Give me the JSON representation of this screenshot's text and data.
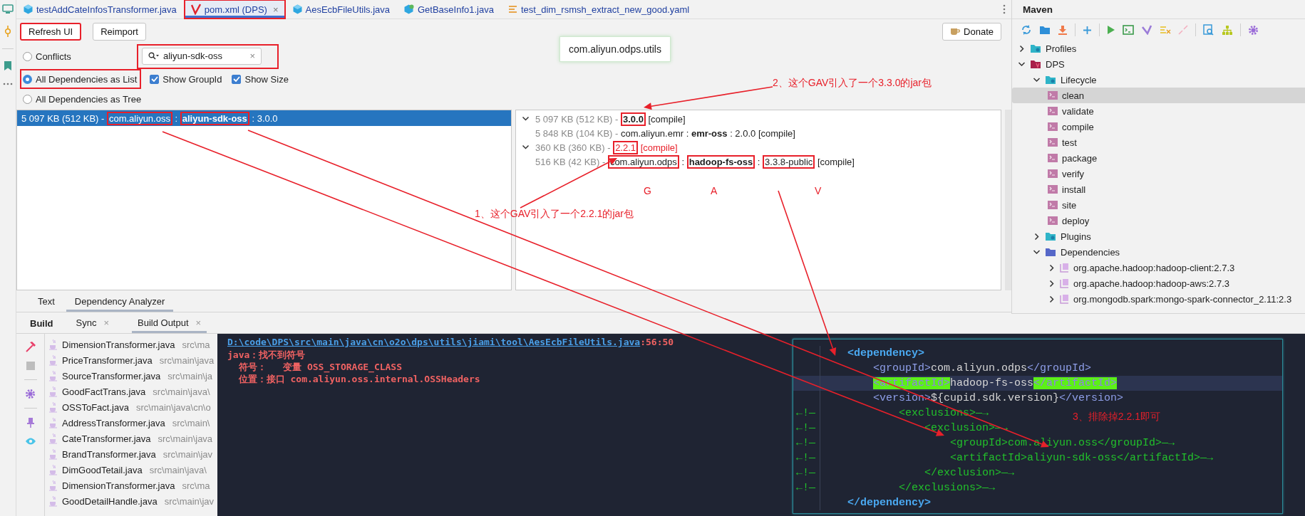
{
  "editor_tabs": [
    {
      "label": "testAddCateInfosTransformer.java",
      "kind": "java",
      "selected": false,
      "annotated": false
    },
    {
      "label": "pom.xml (DPS)",
      "kind": "maven",
      "selected": true,
      "annotated": true,
      "close": "×"
    },
    {
      "label": "AesEcbFileUtils.java",
      "kind": "java",
      "selected": false,
      "annotated": false
    },
    {
      "label": "GetBaseInfo1.java",
      "kind": "class",
      "selected": false,
      "annotated": false
    },
    {
      "label": "test_dim_rsmsh_extract_new_good.yaml",
      "kind": "yaml",
      "selected": false,
      "annotated": false
    }
  ],
  "buttons": [
    {
      "label": "Refresh UI",
      "annotated": true
    },
    {
      "label": "Reimport",
      "annotated": false
    }
  ],
  "donate": {
    "label": "Donate"
  },
  "view_options": [
    {
      "label": "Conflicts",
      "selected": false,
      "annotated": false
    },
    {
      "label": "All Dependencies as List",
      "selected": true,
      "annotated": true
    },
    {
      "label": "All Dependencies as Tree",
      "selected": false,
      "annotated": false
    }
  ],
  "search": {
    "value": "aliyun-sdk-oss",
    "annotated": true,
    "clear": "×"
  },
  "checkboxes": [
    {
      "label": "Show GroupId",
      "checked": true
    },
    {
      "label": "Show Size",
      "checked": true
    }
  ],
  "tooltip": "com.aliyun.odps.utils",
  "dependency_list": [
    {
      "selected": true,
      "segments": [
        {
          "text": "5 097 KB (512 KB) - ",
          "kind": "size",
          "boxed": false
        },
        {
          "text": "com.aliyun.oss",
          "kind": "plain",
          "boxed": true
        },
        {
          "text": " : ",
          "kind": "plain",
          "boxed": false
        },
        {
          "text": "aliyun-sdk-oss",
          "kind": "bold",
          "boxed": true
        },
        {
          "text": " : 3.0.0",
          "kind": "plain",
          "boxed": false
        }
      ]
    }
  ],
  "usage_tree": [
    {
      "expanded": true,
      "segments": [
        {
          "text": "5 097 KB (512 KB) - ",
          "kind": "size",
          "boxed": false
        },
        {
          "text": "3.0.0",
          "kind": "bold",
          "boxed": true
        },
        {
          "text": " [compile]",
          "kind": "plain",
          "boxed": false
        }
      ],
      "children": [
        {
          "segments": [
            {
              "text": "5 848 KB (104 KB) - ",
              "kind": "size",
              "boxed": false
            },
            {
              "text": "com.aliyun.emr : ",
              "kind": "plain",
              "boxed": false
            },
            {
              "text": "emr-oss",
              "kind": "bold",
              "boxed": false
            },
            {
              "text": " : 2.0.0 [compile]",
              "kind": "plain",
              "boxed": false
            }
          ]
        }
      ]
    },
    {
      "expanded": true,
      "segments": [
        {
          "text": "360 KB (360 KB) - ",
          "kind": "size",
          "boxed": false
        },
        {
          "text": "2.2.1",
          "kind": "conflict",
          "boxed": true
        },
        {
          "text": " [compile]",
          "kind": "conflict",
          "boxed": false
        }
      ],
      "children": [
        {
          "segments": [
            {
              "text": "516 KB (42 KB) - ",
              "kind": "size",
              "boxed": false
            },
            {
              "text": "com.aliyun.odps",
              "kind": "plain",
              "boxed": true
            },
            {
              "text": " : ",
              "kind": "plain",
              "boxed": false
            },
            {
              "text": "hadoop-fs-oss",
              "kind": "bold",
              "boxed": true
            },
            {
              "text": " : ",
              "kind": "plain",
              "boxed": false
            },
            {
              "text": "3.3.8-public",
              "kind": "plain",
              "boxed": true
            },
            {
              "text": " [compile]",
              "kind": "plain",
              "boxed": false
            }
          ]
        }
      ]
    }
  ],
  "annotations": [
    {
      "text": "2、这个GAV引入了一个3.3.0的jar包"
    },
    {
      "text": "1、这个GAV引入了一个2.2.1的jar包"
    },
    {
      "text": "G"
    },
    {
      "text": "A"
    },
    {
      "text": "V"
    }
  ],
  "bottom_tabs": [
    {
      "label": "Text",
      "selected": false
    },
    {
      "label": "Dependency Analyzer",
      "selected": true
    }
  ],
  "build": {
    "title": "Build",
    "tabs": [
      {
        "label": "Sync",
        "selected": false,
        "close": "×"
      },
      {
        "label": "Build Output",
        "selected": true,
        "close": "×"
      }
    ],
    "files": [
      {
        "name": "DimensionTransformer.java",
        "path": "src\\ma"
      },
      {
        "name": "PriceTransformer.java",
        "path": "src\\main\\java"
      },
      {
        "name": "SourceTransformer.java",
        "path": "src\\main\\ja"
      },
      {
        "name": "GoodFactTrans.java",
        "path": "src\\main\\java\\"
      },
      {
        "name": "OSSToFact.java",
        "path": "src\\main\\java\\cn\\o"
      },
      {
        "name": "AddressTransformer.java",
        "path": "src\\main\\"
      },
      {
        "name": "CateTransformer.java",
        "path": "src\\main\\java"
      },
      {
        "name": "BrandTransformer.java",
        "path": "src\\main\\jav"
      },
      {
        "name": "DimGoodTetail.java",
        "path": "src\\main\\java\\"
      },
      {
        "name": "DimensionTransformer.java",
        "path": "src\\ma"
      },
      {
        "name": "GoodDetailHandle.java",
        "path": "src\\main\\jav"
      }
    ],
    "console": {
      "link": "D:\\code\\DPS\\src\\main\\java\\cn\\o2o\\dps\\utils\\jiami\\tool\\AesEcbFileUtils.java",
      "position": ":56:50",
      "lines": [
        "java：找不到符号",
        "  符号：   变量 OSS_STORAGE_CLASS",
        "  位置：接口 com.aliyun.oss.internal.OSSHeaders"
      ]
    }
  },
  "code": {
    "note": "3、排除掉2.2.1即可",
    "lines": [
      {
        "current": false,
        "segments": [
          {
            "text": "<dependency>",
            "kind": "root"
          }
        ],
        "children": [
          {
            "current": false,
            "segments": [
              {
                "text": "<groupId>",
                "kind": "tag"
              },
              {
                "text": "com.aliyun.odps",
                "kind": "text"
              },
              {
                "text": "</groupId>",
                "kind": "tag"
              }
            ]
          },
          {
            "current": true,
            "segments": [
              {
                "text": "<artifactId>",
                "kind": "match"
              },
              {
                "text": "hadoop-fs-oss",
                "kind": "text"
              },
              {
                "text": "</artifactId>",
                "kind": "match"
              }
            ]
          },
          {
            "current": false,
            "segments": [
              {
                "text": "<version>",
                "kind": "tag"
              },
              {
                "text": "${cupid.sdk.version}",
                "kind": "text"
              },
              {
                "text": "</version>",
                "kind": "tag"
              }
            ]
          }
        ]
      },
      {
        "current": false,
        "marker": "←!—",
        "segments": [
          {
            "text": "        <exclusions>—→",
            "kind": "comment"
          }
        ]
      },
      {
        "current": false,
        "marker": "←!—",
        "segments": [
          {
            "text": "            <exclusion>—→",
            "kind": "comment"
          }
        ]
      },
      {
        "current": false,
        "marker": "←!—",
        "segments": [
          {
            "text": "                <groupId>com.aliyun.oss</groupId>—→",
            "kind": "comment"
          }
        ]
      },
      {
        "current": false,
        "marker": "←!—",
        "segments": [
          {
            "text": "                <artifactId>aliyun-sdk-oss</artifactId>—→",
            "kind": "comment"
          }
        ]
      },
      {
        "current": false,
        "marker": "←!—",
        "segments": [
          {
            "text": "            </exclusion>—→",
            "kind": "comment"
          }
        ]
      },
      {
        "current": false,
        "marker": "←!—",
        "segments": [
          {
            "text": "        </exclusions>—→",
            "kind": "comment"
          }
        ]
      },
      {
        "current": false,
        "segments": [
          {
            "text": "</dependency>",
            "kind": "root"
          }
        ]
      }
    ]
  },
  "maven": {
    "title": "Maven",
    "tree": [
      {
        "label": "Profiles",
        "kind": "folder",
        "expanded": false,
        "selected": false
      },
      {
        "label": "DPS",
        "kind": "module",
        "expanded": true,
        "selected": false,
        "children": [
          {
            "label": "Lifecycle",
            "kind": "folder",
            "expanded": true,
            "selected": false,
            "children": [
              {
                "label": "clean",
                "kind": "goal",
                "selected": true
              },
              {
                "label": "validate",
                "kind": "goal",
                "selected": false
              },
              {
                "label": "compile",
                "kind": "goal",
                "selected": false
              },
              {
                "label": "test",
                "kind": "goal",
                "selected": false
              },
              {
                "label": "package",
                "kind": "goal",
                "selected": false
              },
              {
                "label": "verify",
                "kind": "goal",
                "selected": false
              },
              {
                "label": "install",
                "kind": "goal",
                "selected": false
              },
              {
                "label": "site",
                "kind": "goal",
                "selected": false
              },
              {
                "label": "deploy",
                "kind": "goal",
                "selected": false
              }
            ]
          },
          {
            "label": "Plugins",
            "kind": "folder",
            "expanded": false,
            "selected": false
          },
          {
            "label": "Dependencies",
            "kind": "deps",
            "expanded": true,
            "selected": false,
            "children": [
              {
                "label": "org.apache.hadoop:hadoop-client:2.7.3",
                "kind": "library",
                "expanded": false,
                "selected": false
              },
              {
                "label": "org.apache.hadoop:hadoop-aws:2.7.3",
                "kind": "library",
                "expanded": false,
                "selected": false
              },
              {
                "label": "org.mongodb.spark:mongo-spark-connector_2.11:2.3",
                "kind": "library",
                "expanded": false,
                "selected": false
              }
            ]
          }
        ]
      }
    ]
  }
}
